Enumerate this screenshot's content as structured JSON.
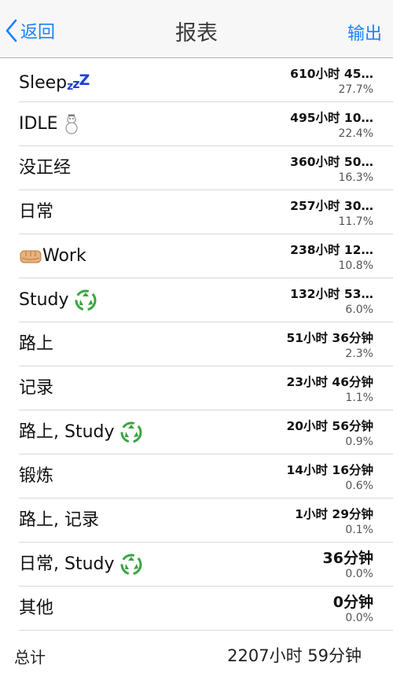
{
  "nav": {
    "back_label": "返回",
    "title": "报表",
    "export_label": "输出"
  },
  "rows": [
    {
      "name": "Sleep",
      "icon": "zzz-icon",
      "duration": "610小时 45…",
      "percent": "27.7%"
    },
    {
      "name": "IDLE",
      "icon": "snowman-icon",
      "duration": "495小时 10…",
      "percent": "22.4%"
    },
    {
      "name": "没正经",
      "duration": "360小时 50…",
      "percent": "16.3%"
    },
    {
      "name": "日常",
      "duration": "257小时 30…",
      "percent": "11.7%"
    },
    {
      "name": "Work",
      "icon": "fist-icon",
      "duration": "238小时 12…",
      "percent": "10.8%"
    },
    {
      "name": "Study",
      "icon": "recycle-icon",
      "duration": "132小时 53…",
      "percent": "6.0%"
    },
    {
      "name": "路上",
      "duration": "51小时 36分钟",
      "percent": "2.3%"
    },
    {
      "name": "记录",
      "duration": "23小时 46分钟",
      "percent": "1.1%"
    },
    {
      "name": "路上, Study",
      "icon": "recycle-icon",
      "duration": "20小时 56分钟",
      "percent": "0.9%"
    },
    {
      "name": "锻炼",
      "duration": "14小时 16分钟",
      "percent": "0.6%"
    },
    {
      "name": "路上, 记录",
      "duration": "1小时 29分钟",
      "percent": "0.1%"
    },
    {
      "name": "日常, Study",
      "icon": "recycle-icon",
      "duration": "36分钟",
      "percent": "0.0%"
    },
    {
      "name": "其他",
      "duration": "0分钟",
      "percent": "0.0%"
    }
  ],
  "total": {
    "label": "总计",
    "value": "2207小时 59分钟"
  },
  "colors": {
    "accent": "#1a82fb",
    "zzz": "#1e3fd6",
    "recycle": "#3aa541"
  }
}
